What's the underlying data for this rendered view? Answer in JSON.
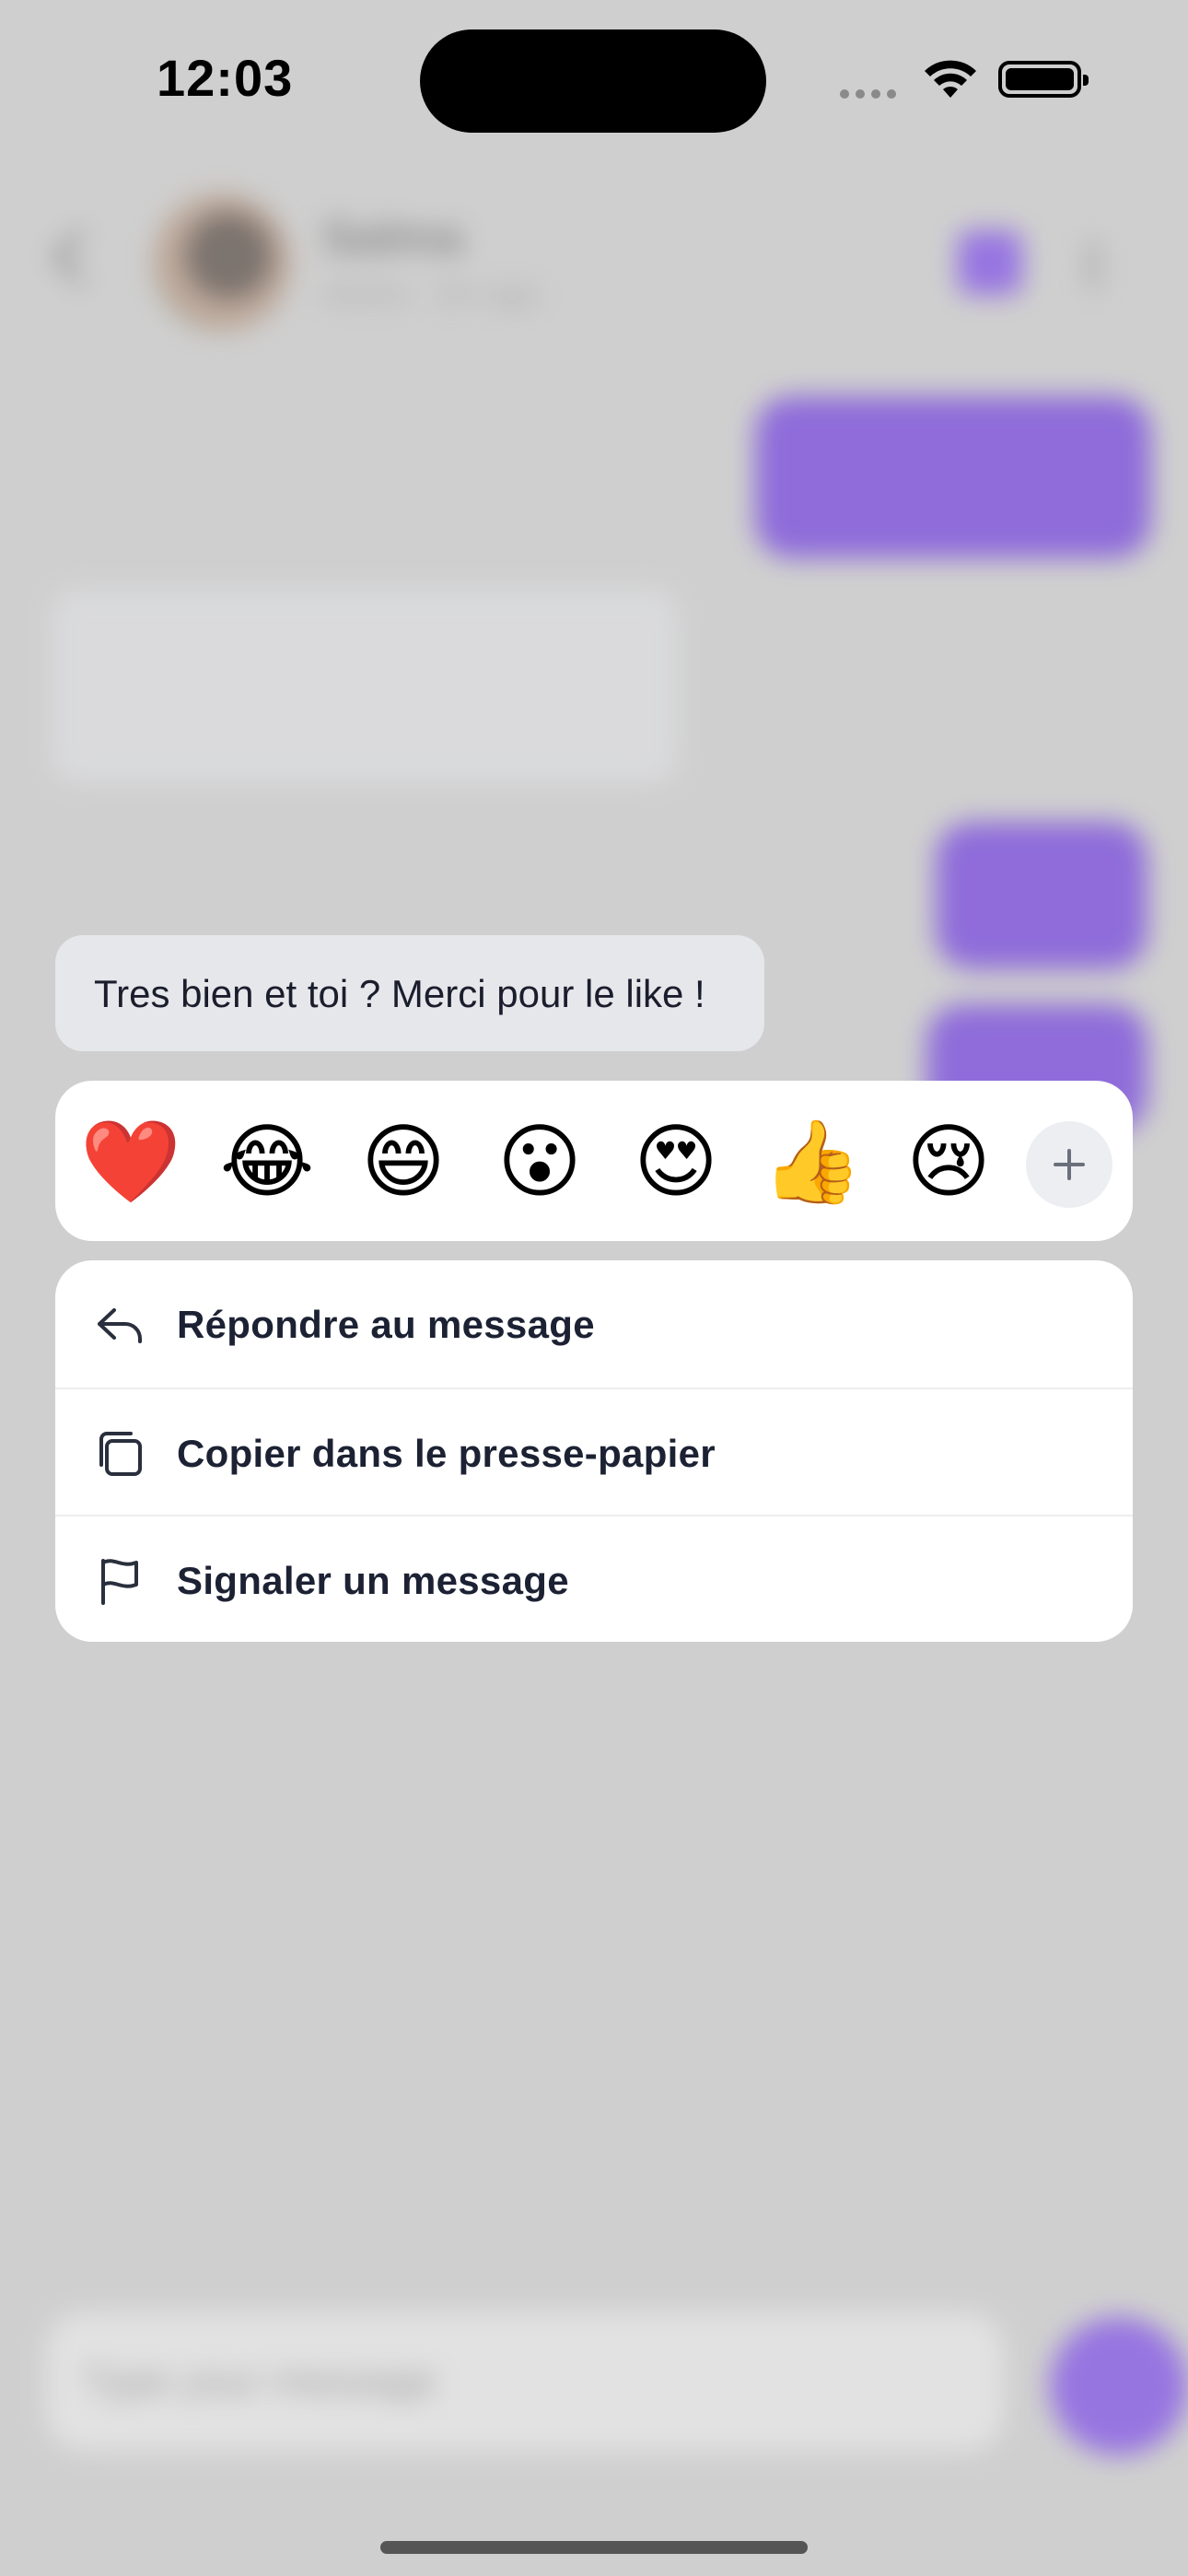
{
  "status_bar": {
    "time": "12:03"
  },
  "background_chat": {
    "contact_name": "Salma",
    "contact_status": "Active · 2m ago",
    "input_placeholder": "Type your message"
  },
  "selected_message": {
    "text": "Tres bien et toi ? Merci pour le like !"
  },
  "reactions": {
    "items": [
      {
        "name": "heart",
        "glyph": "❤️"
      },
      {
        "name": "tears-of-joy",
        "glyph": "😂"
      },
      {
        "name": "grinning",
        "glyph": "😄"
      },
      {
        "name": "surprised",
        "glyph": "😮"
      },
      {
        "name": "heart-eyes",
        "glyph": "😍"
      },
      {
        "name": "thumbs-up",
        "glyph": "👍"
      },
      {
        "name": "crying",
        "glyph": "😢"
      }
    ],
    "add_icon": "plus-icon"
  },
  "menu": {
    "reply": {
      "label": "Répondre au message",
      "icon": "reply-icon"
    },
    "copy": {
      "label": "Copier dans le presse-papier",
      "icon": "copy-icon"
    },
    "report": {
      "label": "Signaler un message",
      "icon": "flag-icon"
    }
  },
  "colors": {
    "accent": "#5b1de3",
    "overlay": "#cfcfcf",
    "bubble_received": "#e6e7eb",
    "text": "#1c2233"
  }
}
